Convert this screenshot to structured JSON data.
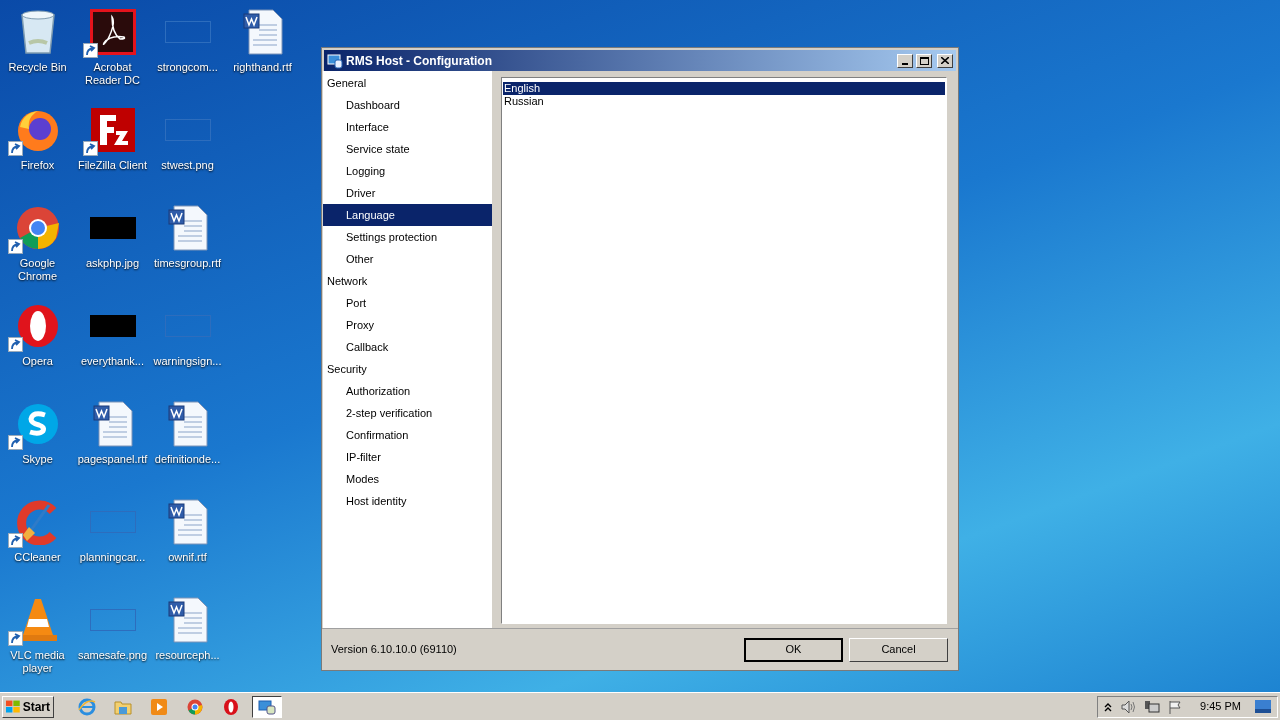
{
  "desktop_icons": [
    {
      "kind": "recycle-bin",
      "label": "Recycle Bin",
      "shortcut": false
    },
    {
      "kind": "firefox",
      "label": "Firefox",
      "shortcut": true
    },
    {
      "kind": "chrome",
      "label": "Google Chrome",
      "shortcut": true
    },
    {
      "kind": "opera",
      "label": "Opera",
      "shortcut": true
    },
    {
      "kind": "skype",
      "label": "Skype",
      "shortcut": true
    },
    {
      "kind": "ccleaner",
      "label": "CCleaner",
      "shortcut": true
    },
    {
      "kind": "vlc",
      "label": "VLC media player",
      "shortcut": true
    },
    {
      "kind": "pdf",
      "label": "Acrobat Reader DC",
      "shortcut": true
    },
    {
      "kind": "filezilla",
      "label": "FileZilla Client",
      "shortcut": true
    },
    {
      "kind": "dark-image",
      "label": "askphp.jpg",
      "shortcut": false
    },
    {
      "kind": "dark-image",
      "label": "everythank...",
      "shortcut": false
    },
    {
      "kind": "document",
      "label": "pagespanel.rtf",
      "shortcut": false
    },
    {
      "kind": "blank-image",
      "label": "planningcar...",
      "shortcut": false
    },
    {
      "kind": "blank-image",
      "label": "samesafe.png",
      "shortcut": false
    },
    {
      "kind": "blank-image",
      "label": "strongcom...",
      "shortcut": false
    },
    {
      "kind": "blank-image",
      "label": "stwest.png",
      "shortcut": false
    },
    {
      "kind": "document",
      "label": "timesgroup.rtf",
      "shortcut": false
    },
    {
      "kind": "blank-image",
      "label": "warningsign...",
      "shortcut": false
    },
    {
      "kind": "document",
      "label": "definitionde...",
      "shortcut": false
    },
    {
      "kind": "document",
      "label": "ownif.rtf",
      "shortcut": false
    },
    {
      "kind": "document",
      "label": "resourceph...",
      "shortcut": false
    },
    {
      "kind": "document",
      "label": "righthand.rtf",
      "shortcut": false
    }
  ],
  "window": {
    "title": "RMS Host - Configuration",
    "tree": [
      {
        "label": "General",
        "selected": false,
        "children": [
          {
            "label": "Dashboard",
            "selected": false
          },
          {
            "label": "Interface",
            "selected": false
          },
          {
            "label": "Service state",
            "selected": false
          },
          {
            "label": "Logging",
            "selected": false
          },
          {
            "label": "Driver",
            "selected": false
          },
          {
            "label": "Language",
            "selected": true
          },
          {
            "label": "Settings protection",
            "selected": false
          },
          {
            "label": "Other",
            "selected": false
          }
        ]
      },
      {
        "label": "Network",
        "selected": false,
        "children": [
          {
            "label": "Port",
            "selected": false
          },
          {
            "label": "Proxy",
            "selected": false
          },
          {
            "label": "Callback",
            "selected": false
          }
        ]
      },
      {
        "label": "Security",
        "selected": false,
        "children": [
          {
            "label": "Authorization",
            "selected": false
          },
          {
            "label": "2-step verification",
            "selected": false
          },
          {
            "label": "Confirmation",
            "selected": false
          },
          {
            "label": "IP-filter",
            "selected": false
          },
          {
            "label": "Modes",
            "selected": false
          },
          {
            "label": "Host identity",
            "selected": false
          }
        ]
      }
    ],
    "languages": [
      {
        "label": "English",
        "selected": true
      },
      {
        "label": "Russian",
        "selected": false
      }
    ],
    "version": "Version 6.10.10.0 (69110)",
    "buttons": [
      {
        "label": "OK",
        "default": true
      },
      {
        "label": "Cancel",
        "default": false
      }
    ]
  },
  "taskbar": {
    "start": "Start",
    "items": [
      {
        "kind": "ie",
        "active": false
      },
      {
        "kind": "folder",
        "active": false
      },
      {
        "kind": "media",
        "active": false
      },
      {
        "kind": "chrome",
        "active": false
      },
      {
        "kind": "opera",
        "active": false
      },
      {
        "kind": "rms",
        "active": true
      }
    ],
    "clock": "9:45 PM"
  }
}
